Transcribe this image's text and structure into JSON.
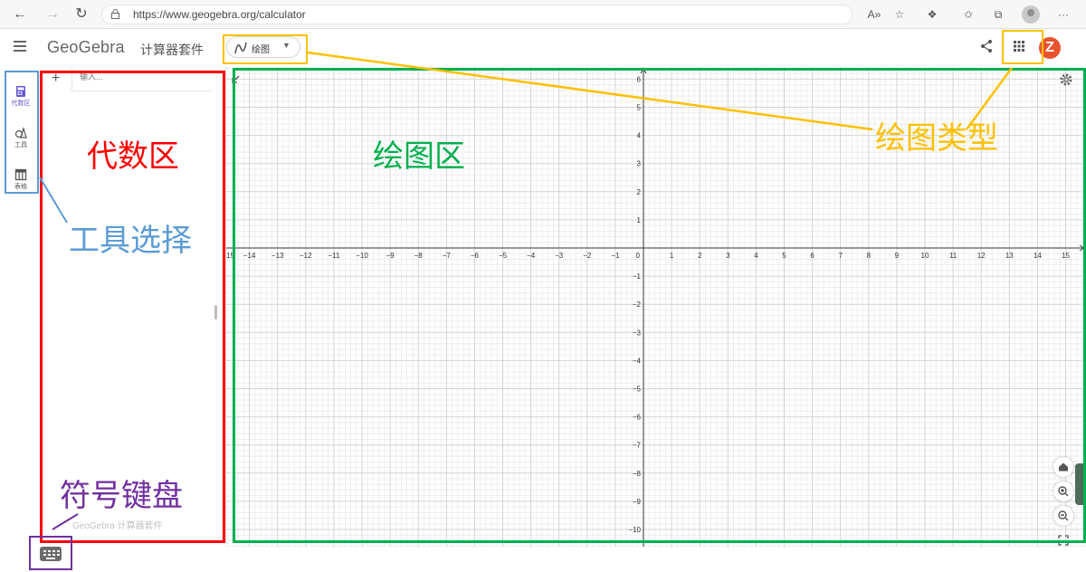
{
  "browser": {
    "url": "https://www.geogebra.org/calculator"
  },
  "header": {
    "logo": "GeoGebra",
    "suite_title": "计算器套件",
    "mode_label": "绘图",
    "avatar_letter": "Z"
  },
  "rail": {
    "items": [
      {
        "label": "代数区",
        "icon": "calculator-icon",
        "active": true
      },
      {
        "label": "工具",
        "icon": "tools-icon",
        "active": false
      },
      {
        "label": "表格",
        "icon": "table-icon",
        "active": false
      }
    ]
  },
  "algebra": {
    "add_label": "+",
    "input_placeholder": "输入...",
    "footer": "GeoGebra 计算器套件"
  },
  "graph": {
    "x_range": [
      -15,
      15
    ],
    "y_range": [
      -10,
      6
    ],
    "grid": true,
    "x_ticks": [
      "15",
      "−14",
      "−13",
      "−12",
      "−11",
      "−10",
      "−9",
      "−8",
      "−7",
      "−6",
      "−5",
      "−4",
      "−3",
      "−2",
      "−1",
      "0",
      "1",
      "2",
      "3",
      "4",
      "5",
      "6",
      "7",
      "8",
      "9",
      "10",
      "11",
      "12",
      "13",
      "14",
      "15"
    ],
    "y_ticks": [
      "6",
      "5",
      "4",
      "3",
      "2",
      "1",
      "−1",
      "−2",
      "−3",
      "−4",
      "−5",
      "−6",
      "−7",
      "−8",
      "−9",
      "−10"
    ]
  },
  "annotations": {
    "algebra_area": "代数区",
    "graphics_area": "绘图区",
    "graph_type": "绘图类型",
    "tool_select": "工具选择",
    "keyboard": "符号键盘"
  },
  "colors": {
    "annotation_red": "#ff0000",
    "annotation_green": "#00b050",
    "annotation_yellow": "#ffc000",
    "annotation_blue": "#5b9bd5",
    "annotation_purple": "#7030a0",
    "accent_purple": "#6557d2",
    "avatar_orange": "#e9542f"
  }
}
